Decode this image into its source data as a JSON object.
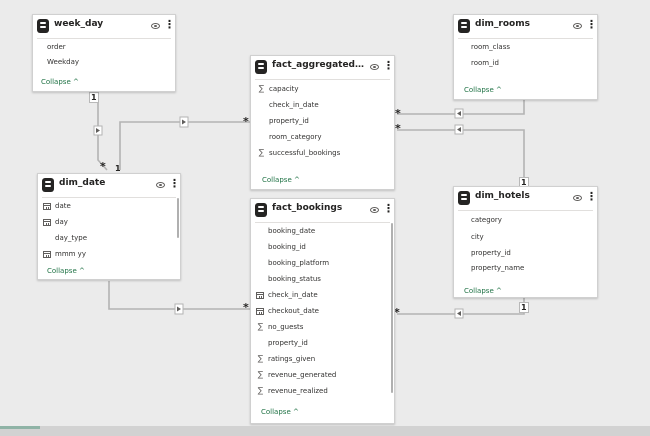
{
  "tables": {
    "week_day": {
      "name": "week_day",
      "fields": [
        "order",
        "Weekday"
      ],
      "collapse": "Collapse"
    },
    "dim_rooms": {
      "name": "dim_rooms",
      "fields": [
        "room_class",
        "room_id"
      ],
      "collapse": "Collapse"
    },
    "fact_aggregated": {
      "name": "fact_aggregated_boo...",
      "fields": [
        "capacity",
        "check_in_date",
        "property_id",
        "room_category",
        "successful_bookings"
      ],
      "collapse": "Collapse"
    },
    "dim_date": {
      "name": "dim_date",
      "fields": [
        "date",
        "day",
        "day_type",
        "mmm yy"
      ],
      "collapse": "Collapse"
    },
    "fact_bookings": {
      "name": "fact_bookings",
      "fields": [
        "booking_date",
        "booking_id",
        "booking_platform",
        "booking_status",
        "check_in_date",
        "checkout_date",
        "no_guests",
        "property_id",
        "ratings_given",
        "revenue_generated",
        "revenue_realized"
      ],
      "collapse": "Collapse"
    },
    "dim_hotels": {
      "name": "dim_hotels",
      "fields": [
        "category",
        "city",
        "property_id",
        "property_name"
      ],
      "collapse": "Collapse"
    }
  },
  "relationships": {
    "weekday_one": "1",
    "date_many": "*",
    "date_one_top": "1",
    "agg_many_left": "*",
    "agg_many_right1": "*",
    "agg_many_right2": "*",
    "hotels_one_top": "1",
    "bookings_many": "*",
    "hotels_one_right": "1",
    "bookings_many_right": "*"
  }
}
